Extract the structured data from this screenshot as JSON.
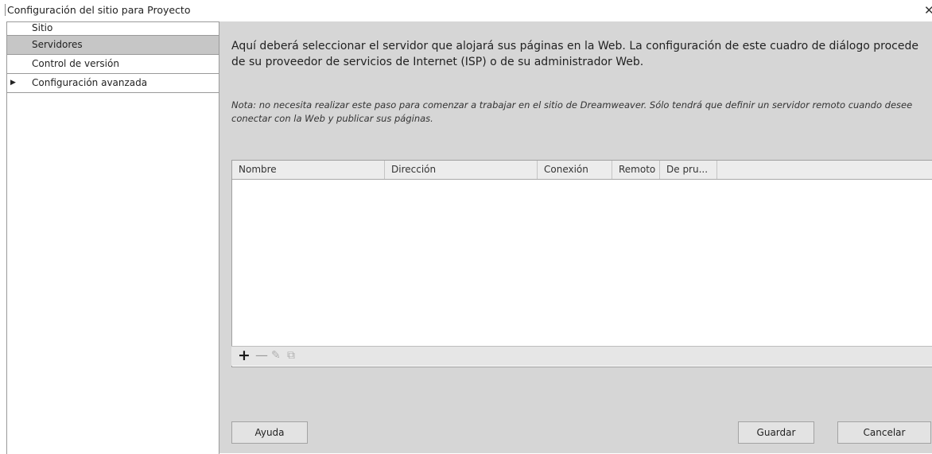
{
  "window": {
    "title": "Configuración del sitio para Proyecto",
    "close_glyph": "✕"
  },
  "sidebar": {
    "items": [
      {
        "label": "Sitio"
      },
      {
        "label": "Servidores",
        "selected": true
      },
      {
        "label": "Control de versión"
      },
      {
        "label": "Configuración avanzada",
        "expandable": true
      }
    ]
  },
  "main": {
    "description": "Aquí deberá seleccionar el servidor que alojará sus páginas en la Web. La configuración de este cuadro de diálogo procede de su proveedor de servicios de Internet (ISP) o de su administrador Web.",
    "note": "Nota: no necesita realizar este paso para comenzar a trabajar en el sitio de Dreamweaver. Sólo tendrá que definir un servidor remoto cuando desee conectar con la Web y publicar sus páginas.",
    "table": {
      "columns": [
        "Nombre",
        "Dirección",
        "Conexión",
        "Remoto",
        "De pru..."
      ],
      "rows": []
    },
    "toolbar": {
      "add": "+",
      "remove": "—",
      "edit": "✎",
      "duplicate": "⧉"
    }
  },
  "buttons": {
    "help": "Ayuda",
    "save": "Guardar",
    "cancel": "Cancelar"
  },
  "colors": {
    "selected_row": "#c6c6c6",
    "panel_background": "#d6d6d6"
  }
}
